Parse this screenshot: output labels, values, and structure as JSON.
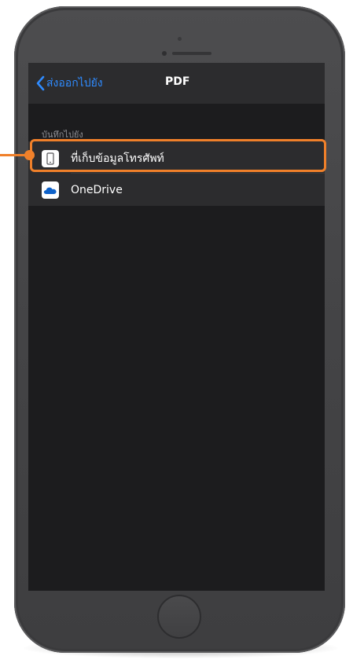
{
  "nav": {
    "back_label": "ส่งออกไปยัง",
    "title": "PDF"
  },
  "section": {
    "header": "บันทึกไปยัง"
  },
  "destinations": [
    {
      "label": "ที่เก็บข้อมูลโทรศัพท์",
      "icon": "phone-storage-icon",
      "highlighted": true
    },
    {
      "label": "OneDrive",
      "icon": "onedrive-cloud-icon",
      "highlighted": false
    }
  ],
  "colors": {
    "accent": "#2f8bff",
    "highlight": "#f0802a",
    "screen_bg": "#1c1c1e",
    "cell_bg": "#2c2c2e",
    "onedrive_blue": "#0f62c9"
  }
}
